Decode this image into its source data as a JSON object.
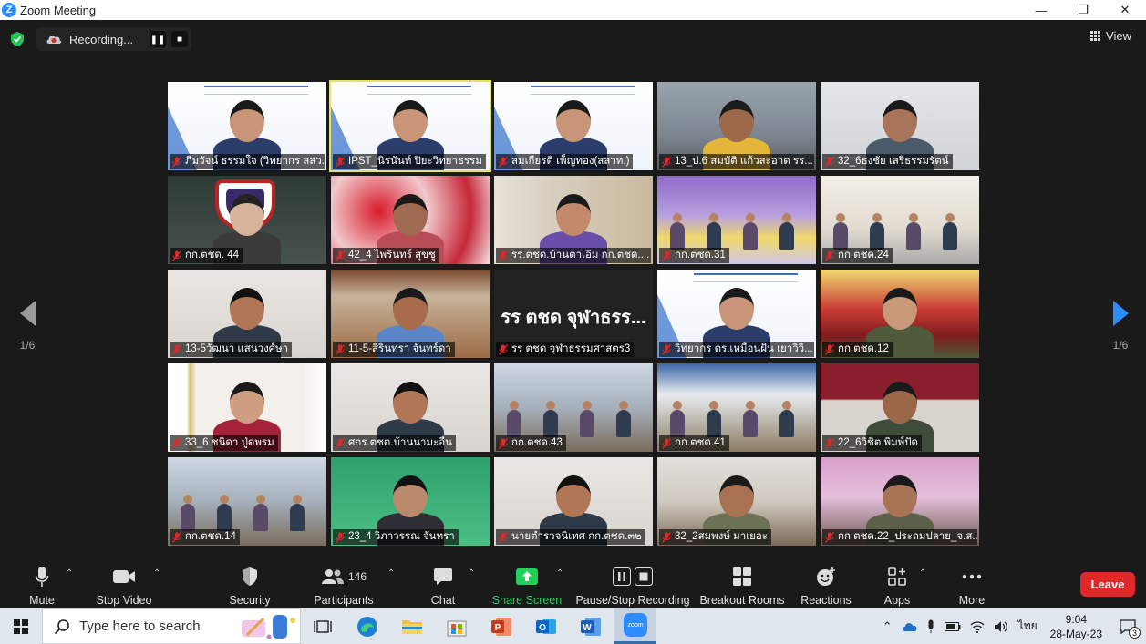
{
  "window": {
    "title": "Zoom Meeting",
    "controls": [
      "—",
      "❐",
      "✕"
    ]
  },
  "recording": {
    "label": "Recording..."
  },
  "view": {
    "label": "View"
  },
  "pager": {
    "left": "1/6",
    "right": "1/6"
  },
  "tiles": [
    {
      "name": "ภีมวัจน์ ธรรมใจ (วิทยากร สสว...",
      "speaking": false,
      "scene": "slide"
    },
    {
      "name": "IPST_นิรนันท์ ปิยะวิทยาธรรม",
      "speaking": true,
      "scene": "slide"
    },
    {
      "name": "สมเกียรติ เพ็ญทอง(สสวท.)",
      "speaking": false,
      "scene": "slide"
    },
    {
      "name": "13_ป.6 สมบัติ แก้วสะอาด รร...",
      "speaking": false,
      "scene": "room"
    },
    {
      "name": "32_6ธงชัย เสรีธรรมรัตน์",
      "speaking": false,
      "scene": "wall"
    },
    {
      "name": "กก.ตชด. 44",
      "speaking": false,
      "scene": "logo"
    },
    {
      "name": "42_4 ไพรินทร์ สุขชู",
      "speaking": false,
      "scene": "red"
    },
    {
      "name": "รร.ตชด.บ้านตาเอิม กก.ตชด....",
      "speaking": false,
      "scene": "door"
    },
    {
      "name": "กก.ตชด.31",
      "speaking": false,
      "scene": "purple"
    },
    {
      "name": "กก.ตชด.24",
      "speaking": false,
      "scene": "classroom"
    },
    {
      "name": "13-5วัฒนา แสนวงศ์ษา",
      "speaking": false,
      "scene": "white"
    },
    {
      "name": "11-5-สิรินทรา จันทร์ดา",
      "speaking": false,
      "scene": "window"
    },
    {
      "name": "รร ตชด จุฬาธรรมศาสตร3",
      "speaking": false,
      "scene": "name",
      "display_name": "รร ตชด จุฬาธรร..."
    },
    {
      "name": "วิทยากร ดร.เหมือนฝัน เยาวิวิ...",
      "speaking": false,
      "scene": "slide"
    },
    {
      "name": "กก.ตชด.12",
      "speaking": false,
      "scene": "banner"
    },
    {
      "name": "33_6 ชนิดา ปู่ดพรม",
      "speaking": false,
      "scene": "room2"
    },
    {
      "name": "ศกร.ตชด.บ้านนามะอื่น",
      "speaking": false,
      "scene": "white"
    },
    {
      "name": "กก.ตชด.43",
      "speaking": false,
      "scene": "meeting"
    },
    {
      "name": "กก.ตชด.41",
      "speaking": false,
      "scene": "desk"
    },
    {
      "name": "22_6วิชิต พิมพ์ปัด",
      "speaking": false,
      "scene": "board"
    },
    {
      "name": "กก.ตชด.14",
      "speaking": false,
      "scene": "meeting"
    },
    {
      "name": "23_4 วิภาวรรณ จันทรา",
      "speaking": false,
      "scene": "green"
    },
    {
      "name": "นายตำรวจนิเทศ กก.ตชด.๓๒",
      "speaking": false,
      "scene": "white"
    },
    {
      "name": "32_2สมพงษ์ มาเยอะ",
      "speaking": false,
      "scene": "office"
    },
    {
      "name": "กก.ตชด.22_ประถมปลาย_จ.ส...",
      "speaking": false,
      "scene": "pink"
    }
  ],
  "toolbar": {
    "mute": "Mute",
    "stop_video": "Stop Video",
    "security": "Security",
    "participants": "Participants",
    "participants_count": "146",
    "chat": "Chat",
    "share_screen": "Share Screen",
    "pause_stop_recording": "Pause/Stop Recording",
    "breakout_rooms": "Breakout Rooms",
    "reactions": "Reactions",
    "apps": "Apps",
    "more": "More",
    "leave": "Leave"
  },
  "taskbar": {
    "search_placeholder": "Type here to search",
    "language": "ไทย",
    "time": "9:04",
    "date": "28-May-23",
    "notifications": "3",
    "zoom_label": "zoom"
  },
  "colors": {
    "accent": "#2d8cff",
    "leave": "#e02828",
    "share_green": "#1fd05a",
    "speaking_outline": "#e6e35c"
  }
}
